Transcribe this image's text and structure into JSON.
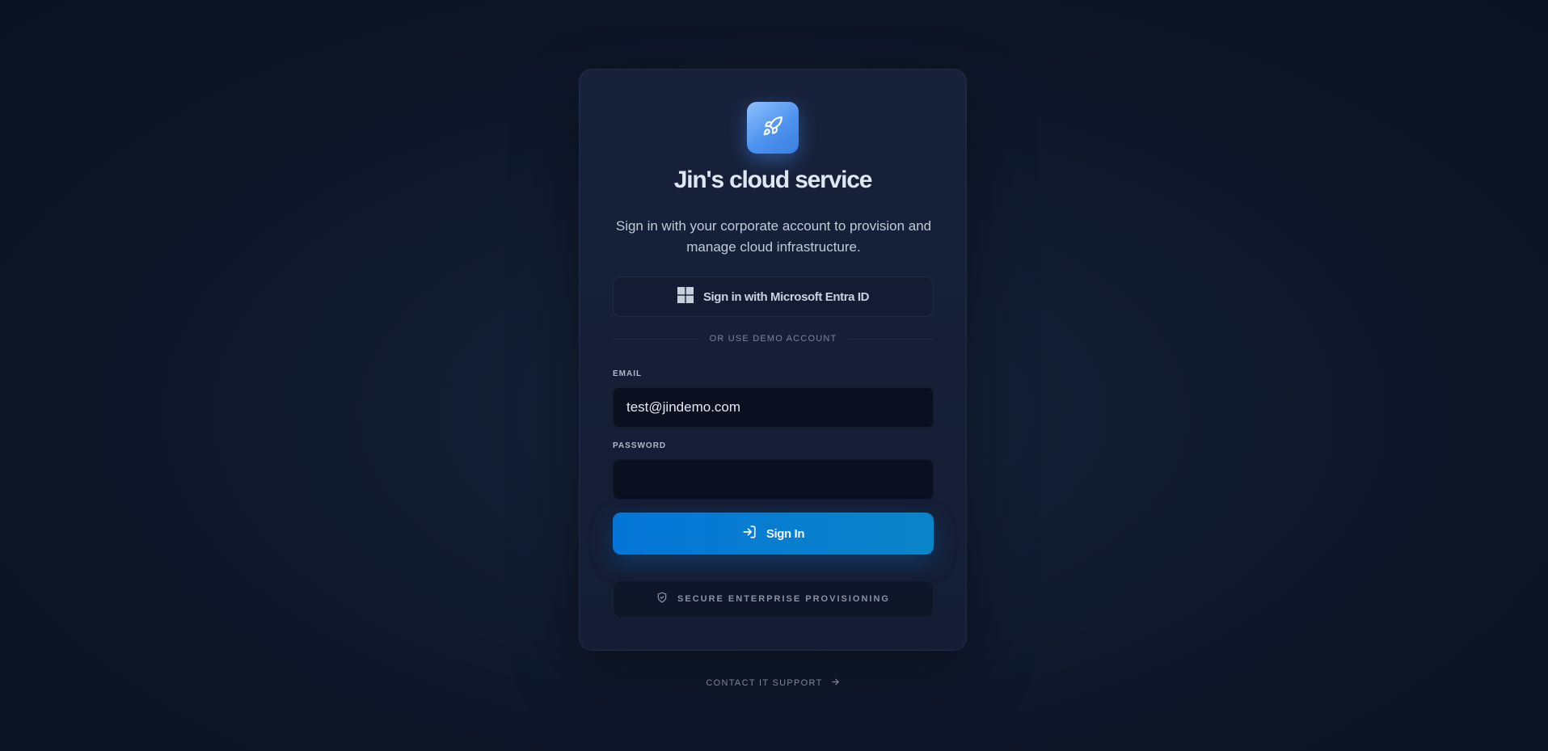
{
  "app": {
    "title": "Jin's cloud service",
    "subtitle": "Sign in with your corporate account to provision and manage cloud infrastructure.",
    "logo_icon": "rocket-icon",
    "accent_color": "#0576d8"
  },
  "sso": {
    "label": "Sign in with Microsoft Entra ID",
    "icon": "windows-icon"
  },
  "divider": {
    "text": "OR USE DEMO ACCOUNT"
  },
  "form": {
    "email_label": "EMAIL",
    "email_value": "test@jindemo.com",
    "password_label": "PASSWORD",
    "password_value": "",
    "submit_label": "Sign In",
    "submit_icon": "sign-in-icon"
  },
  "badge": {
    "label": "SECURE ENTERPRISE PROVISIONING",
    "icon": "shield-check-icon"
  },
  "footer": {
    "support_label": "CONTACT IT SUPPORT",
    "support_icon": "arrow-right-icon"
  }
}
